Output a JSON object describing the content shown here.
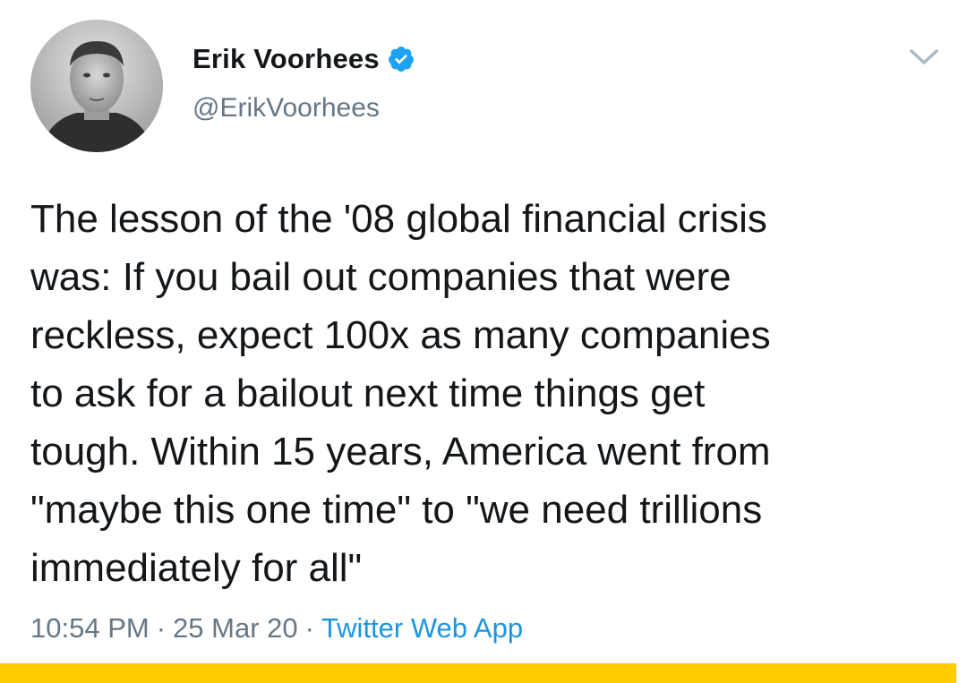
{
  "author": {
    "display_name": "Erik Voorhees",
    "handle": "@ErikVoorhees",
    "verified": true
  },
  "tweet": {
    "text": "The lesson of the '08 global financial crisis\nwas:  If you bail out companies that were\nreckless, expect 100x as many companies\nto ask for a bailout next time things get\ntough. Within 15 years, America went from\n\"maybe this one time\" to \"we need trillions\nimmediately for all\"",
    "time": "10:54 PM",
    "date": "25 Mar 20",
    "source": "Twitter Web App",
    "separator": "·"
  },
  "icons": {
    "verified": "verified-badge-icon",
    "menu": "chevron-down-icon"
  },
  "colors": {
    "text": "#14171a",
    "secondary": "#657786",
    "link": "#1b95e0",
    "verified": "#1da1f2",
    "bottom_bar": "#ffcc00"
  }
}
